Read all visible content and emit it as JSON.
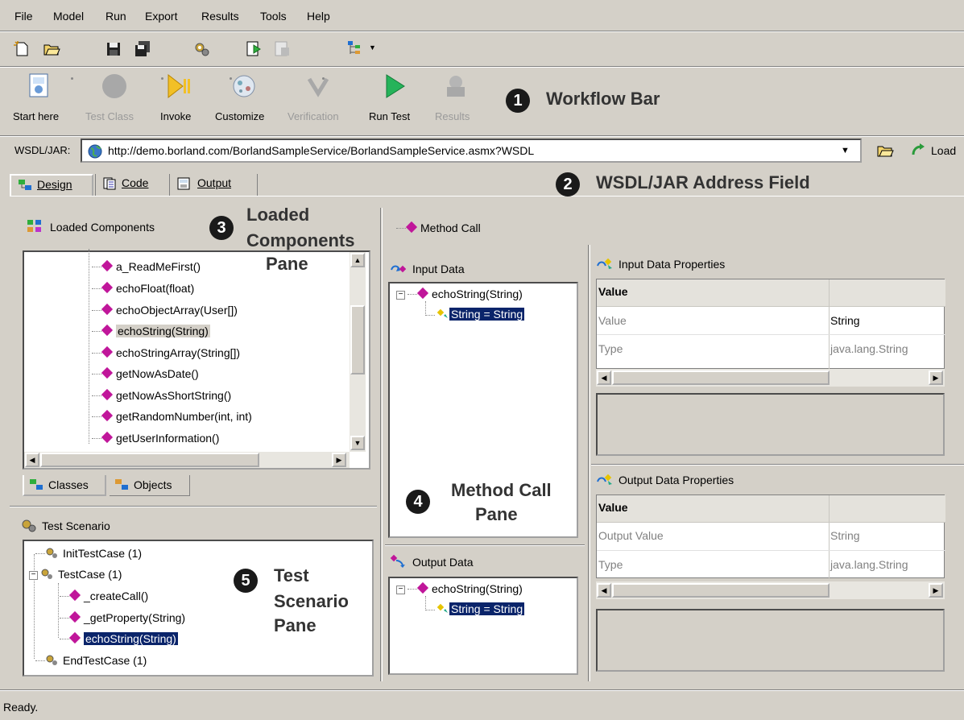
{
  "menu": [
    "File",
    "Model",
    "Run",
    "Export",
    "Results",
    "Tools",
    "Help"
  ],
  "workflow": {
    "buttons": [
      {
        "label": "Start here",
        "enabled": true
      },
      {
        "label": "Test Class",
        "enabled": false
      },
      {
        "label": "Invoke",
        "enabled": true
      },
      {
        "label": "Customize",
        "enabled": true
      },
      {
        "label": "Verification",
        "enabled": false
      },
      {
        "label": "Run Test",
        "enabled": true
      },
      {
        "label": "Results",
        "enabled": false
      }
    ]
  },
  "callouts": {
    "c1": {
      "num": "1",
      "text": "Workflow Bar"
    },
    "c2": {
      "num": "2",
      "text": "WSDL/JAR Address Field"
    },
    "c3": {
      "num": "3",
      "line1": "Loaded",
      "line2": "Components",
      "line3": "Pane"
    },
    "c4": {
      "num": "4",
      "line1": "Method Call",
      "line2": "Pane"
    },
    "c5": {
      "num": "5",
      "line1": "Test",
      "line2": "Scenario",
      "line3": "Pane"
    }
  },
  "address": {
    "label": "WSDL/JAR:",
    "value": "http://demo.borland.com/BorlandSampleService/BorlandSampleService.asmx?WSDL",
    "load_label": "Load"
  },
  "tabs": [
    "Design",
    "Code",
    "Output"
  ],
  "loaded_components": {
    "title": "Loaded Components",
    "items": [
      "a_ReadMeFirst()",
      "echoFloat(float)",
      "echoObjectArray(User[])",
      "echoString(String)",
      "echoStringArray(String[])",
      "getNowAsDate()",
      "getNowAsShortString()",
      "getRandomNumber(int, int)",
      "getUserInformation()"
    ],
    "subtabs": [
      "Classes",
      "Objects"
    ]
  },
  "test_scenario": {
    "title": "Test Scenario",
    "items": [
      "InitTestCase (1)",
      "TestCase (1)",
      "_createCall()",
      "_getProperty(String)",
      "echoString(String)",
      "EndTestCase (1)"
    ]
  },
  "method_call": {
    "title": "Method Call",
    "input_title": "Input Data",
    "input_method": "echoString(String)",
    "input_param": "String = String",
    "output_title": "Output Data",
    "output_method": "echoString(String)",
    "output_param": "String = String"
  },
  "input_props": {
    "title": "Input Data Properties",
    "header": "Value",
    "rows": [
      [
        "Value",
        "String"
      ],
      [
        "Type",
        "java.lang.String"
      ]
    ]
  },
  "output_props": {
    "title": "Output Data Properties",
    "header": "Value",
    "rows": [
      [
        "Output Value",
        "String"
      ],
      [
        "Type",
        "java.lang.String"
      ]
    ]
  },
  "status": "Ready."
}
